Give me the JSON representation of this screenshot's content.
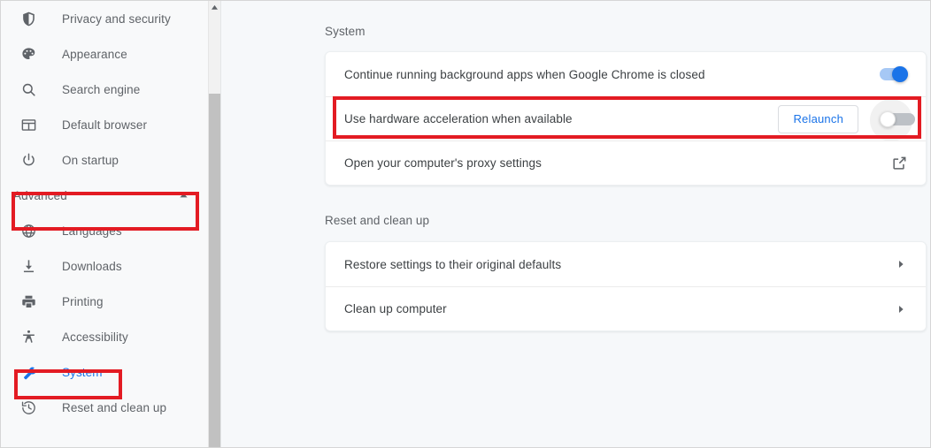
{
  "sidebar": {
    "items": [
      {
        "label": "Privacy and security",
        "icon": "shield-icon",
        "selected": false
      },
      {
        "label": "Appearance",
        "icon": "palette-icon",
        "selected": false
      },
      {
        "label": "Search engine",
        "icon": "search-icon",
        "selected": false
      },
      {
        "label": "Default browser",
        "icon": "browser-window-icon",
        "selected": false
      },
      {
        "label": "On startup",
        "icon": "power-icon",
        "selected": false
      }
    ],
    "advanced": {
      "label": "Advanced",
      "icon": "chevron-up-icon",
      "expanded": true
    },
    "advanced_items": [
      {
        "label": "Languages",
        "icon": "globe-icon",
        "selected": false
      },
      {
        "label": "Downloads",
        "icon": "download-icon",
        "selected": false
      },
      {
        "label": "Printing",
        "icon": "printer-icon",
        "selected": false
      },
      {
        "label": "Accessibility",
        "icon": "accessibility-icon",
        "selected": false
      },
      {
        "label": "System",
        "icon": "wrench-icon",
        "selected": true
      },
      {
        "label": "Reset and clean up",
        "icon": "history-icon",
        "selected": false
      }
    ],
    "scrollbar": {
      "arrow_icon": "scroll-up-arrow-icon"
    }
  },
  "main": {
    "sections": [
      {
        "title": "System",
        "rows": [
          {
            "label": "Continue running background apps when Google Chrome is closed",
            "control": "toggle",
            "toggle_state": "on"
          },
          {
            "label": "Use hardware acceleration when available",
            "control": "button-and-toggle",
            "button_label": "Relaunch",
            "toggle_state": "off",
            "highlighted": true
          },
          {
            "label": "Open your computer's proxy settings",
            "control": "external-link",
            "icon": "external-link-icon"
          }
        ]
      },
      {
        "title": "Reset and clean up",
        "rows": [
          {
            "label": "Restore settings to their original defaults",
            "control": "chevron",
            "icon": "chevron-right-icon"
          },
          {
            "label": "Clean up computer",
            "control": "chevron",
            "icon": "chevron-right-icon"
          }
        ]
      }
    ]
  },
  "colors": {
    "accent_blue": "#1a73e8",
    "highlight_red": "#e31b23",
    "text_primary": "#3c4043",
    "text_secondary": "#5f6368",
    "page_background": "#f6f8fa",
    "sidebar_background": "#f8f9fa",
    "card_background": "#ffffff",
    "toggle_off_track": "#bdc1c6",
    "scrollbar_thumb": "#c1c1c1"
  }
}
